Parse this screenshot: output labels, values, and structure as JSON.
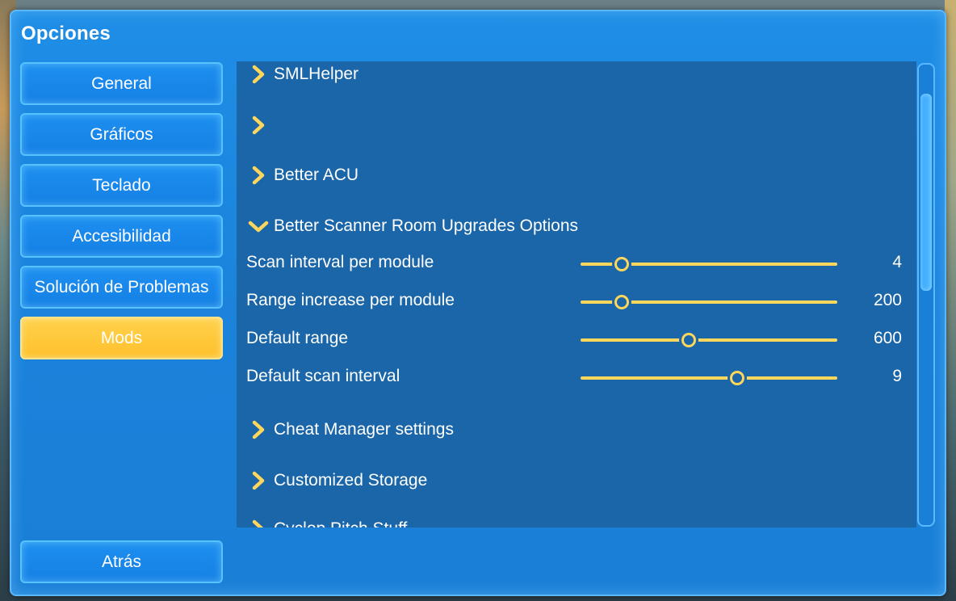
{
  "window": {
    "title": "Opciones"
  },
  "sidebar": {
    "items": [
      {
        "label": "General",
        "active": false
      },
      {
        "label": "Gráficos",
        "active": false
      },
      {
        "label": "Teclado",
        "active": false
      },
      {
        "label": "Accesibilidad",
        "active": false
      },
      {
        "label": "Solución de Problemas",
        "active": false
      },
      {
        "label": "Mods",
        "active": true
      }
    ],
    "back_label": "Atrás"
  },
  "mods": {
    "groups": [
      {
        "label": "SMLHelper",
        "expanded": false
      },
      {
        "label": "",
        "expanded": false
      },
      {
        "label": "Better ACU",
        "expanded": false
      },
      {
        "label": "Better Scanner Room Upgrades Options",
        "expanded": true
      },
      {
        "label": "Cheat Manager settings",
        "expanded": false
      },
      {
        "label": "Customized Storage",
        "expanded": false
      },
      {
        "label": "Cyclop Pitch Stuff",
        "expanded": false
      }
    ],
    "settings": [
      {
        "label": "Scan interval per module",
        "value": "4",
        "fraction": 0.16
      },
      {
        "label": "Range increase per module",
        "value": "200",
        "fraction": 0.16
      },
      {
        "label": "Default range",
        "value": "600",
        "fraction": 0.42
      },
      {
        "label": "Default scan interval",
        "value": "9",
        "fraction": 0.61
      }
    ]
  },
  "colors": {
    "panel": "#1b86de",
    "content": "#1a66a8",
    "accent": "#ffc02b",
    "slider": "#ffd65c"
  }
}
